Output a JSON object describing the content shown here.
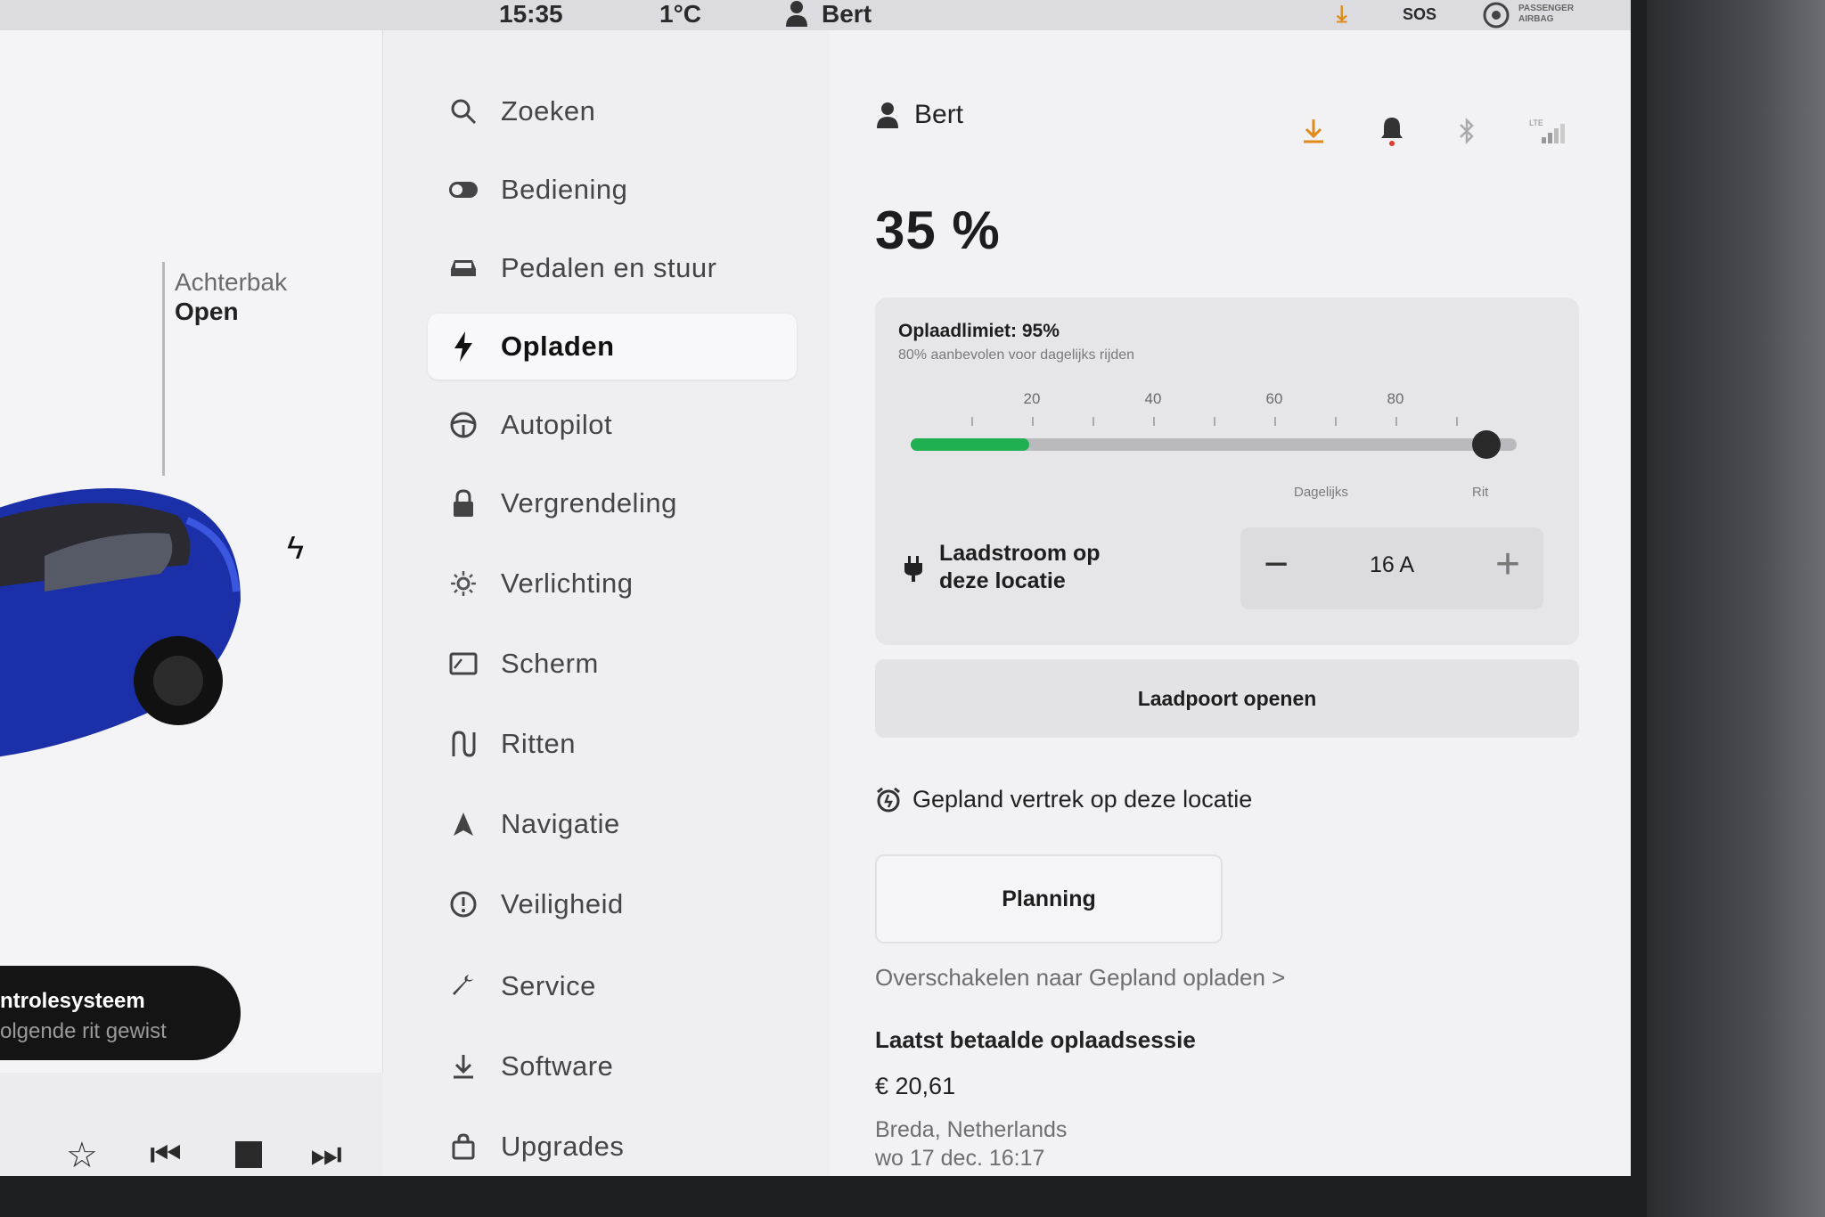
{
  "status_bar": {
    "time": "15:35",
    "temperature": "1°C",
    "user": "Bert",
    "sos": "SOS",
    "airbag_label": "PASSENGER AIRBAG"
  },
  "left_panel": {
    "trunk_label": "Achterbak",
    "trunk_status": "Open",
    "toast_line1": "ntrolesysteem",
    "toast_line2": "olgende rit gewist"
  },
  "menu": {
    "items": [
      {
        "label": "Zoeken",
        "icon": "search-icon"
      },
      {
        "label": "Bediening",
        "icon": "toggle-icon"
      },
      {
        "label": "Pedalen en stuur",
        "icon": "car-icon"
      },
      {
        "label": "Opladen",
        "icon": "lightning-icon",
        "active": true
      },
      {
        "label": "Autopilot",
        "icon": "steering-wheel-icon"
      },
      {
        "label": "Vergrendeling",
        "icon": "lock-icon"
      },
      {
        "label": "Verlichting",
        "icon": "light-icon"
      },
      {
        "label": "Scherm",
        "icon": "screen-icon"
      },
      {
        "label": "Ritten",
        "icon": "trips-icon"
      },
      {
        "label": "Navigatie",
        "icon": "navigation-icon"
      },
      {
        "label": "Veiligheid",
        "icon": "safety-icon"
      },
      {
        "label": "Service",
        "icon": "wrench-icon"
      },
      {
        "label": "Software",
        "icon": "download-icon"
      },
      {
        "label": "Upgrades",
        "icon": "bag-icon"
      }
    ]
  },
  "charging": {
    "user": "Bert",
    "battery_percent": "35 %",
    "battery_level": 0.35,
    "limit_title": "Oplaadlimiet: 95%",
    "limit_subtitle": "80% aanbevolen voor dagelijks rijden",
    "limit_value": 0.95,
    "tick_labels": [
      "20",
      "40",
      "60",
      "80"
    ],
    "range_daily": "Dagelijks",
    "range_trip": "Rit",
    "current_label_line1": "Laadstroom op",
    "current_label_line2": "deze locatie",
    "current_value": "16 A",
    "open_port_label": "Laadpoort openen",
    "departure_label": "Gepland vertrek op deze locatie",
    "planning_label": "Planning",
    "switch_link": "Overschakelen naar Gepland opladen >",
    "last_session_title": "Laatst betaalde oplaadsessie",
    "last_session_amount": "€ 20,61",
    "last_session_location": "Breda, Netherlands",
    "last_session_date": "wo 17 dec. 16:17"
  },
  "colors": {
    "accent_green": "#20b052",
    "download_orange": "#e08a1a",
    "notification_red": "#e23a2a"
  }
}
